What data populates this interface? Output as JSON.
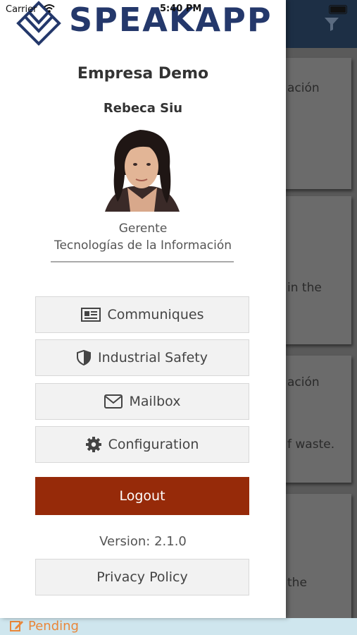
{
  "status_bar": {
    "carrier": "Carrier",
    "time": "5:40 PM"
  },
  "brand": {
    "name": "SPEAKAPP",
    "color": "#24386b"
  },
  "profile": {
    "company": "Empresa Demo",
    "name": "Rebeca Siu",
    "role": "Gerente",
    "department": "Tecnologías de la Información"
  },
  "menu": {
    "items": [
      {
        "label": "Communiques",
        "icon": "newspaper-icon"
      },
      {
        "label": "Industrial Safety",
        "icon": "shield-icon"
      },
      {
        "label": "Mailbox",
        "icon": "envelope-icon"
      },
      {
        "label": "Configuration",
        "icon": "gear-icon"
      }
    ],
    "logout_label": "Logout",
    "logout_color": "#962a09",
    "version": "Version: 2.1.0",
    "privacy_label": "Privacy Policy"
  },
  "background": {
    "snippets": [
      "ación",
      "in the",
      "ación",
      "f waste.",
      "the"
    ],
    "pending_label": "Pending",
    "pending_color": "#e9873a"
  }
}
